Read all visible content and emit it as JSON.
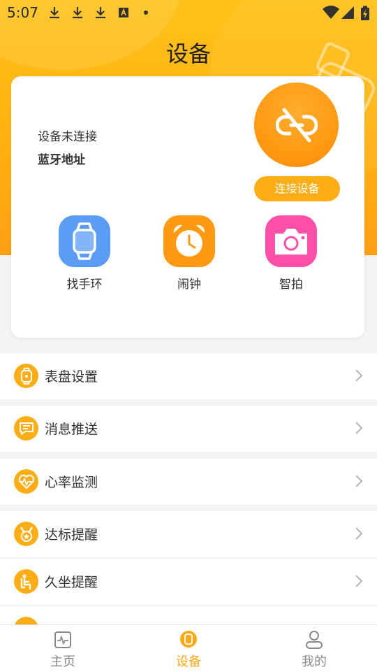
{
  "status_bar": {
    "time": "5:07",
    "icons": [
      "download-icon",
      "download-icon",
      "download-icon",
      "app-notification-icon",
      "dot-icon",
      "wifi-icon",
      "signal-icon",
      "battery-icon"
    ]
  },
  "header": {
    "title": "设备"
  },
  "device_card": {
    "connection_status": "设备未连接",
    "bluetooth_address_label": "蓝牙地址",
    "connect_button_label": "连接设备",
    "features": [
      {
        "label": "找手环",
        "icon": "watch-icon",
        "color": "#5b9cf7"
      },
      {
        "label": "闹钟",
        "icon": "alarm-clock-icon",
        "color": "#ff9a12"
      },
      {
        "label": "智拍",
        "icon": "camera-icon",
        "color": "#ff4fa9"
      }
    ]
  },
  "settings": [
    {
      "label": "表盘设置",
      "icon": "watch-face-icon"
    },
    {
      "label": "消息推送",
      "icon": "message-icon"
    },
    {
      "label": "心率监测",
      "icon": "heart-rate-icon"
    },
    {
      "label": "达标提醒",
      "icon": "medal-icon"
    },
    {
      "label": "久坐提醒",
      "icon": "sitting-icon"
    }
  ],
  "tabs": [
    {
      "label": "主页",
      "icon": "activity-icon",
      "active": false
    },
    {
      "label": "设备",
      "icon": "watch-icon",
      "active": true
    },
    {
      "label": "我的",
      "icon": "profile-icon",
      "active": false
    }
  ],
  "colors": {
    "accent": "#ffad14",
    "active_tab": "#ffa812",
    "inactive_tab": "#8a8a8a"
  }
}
